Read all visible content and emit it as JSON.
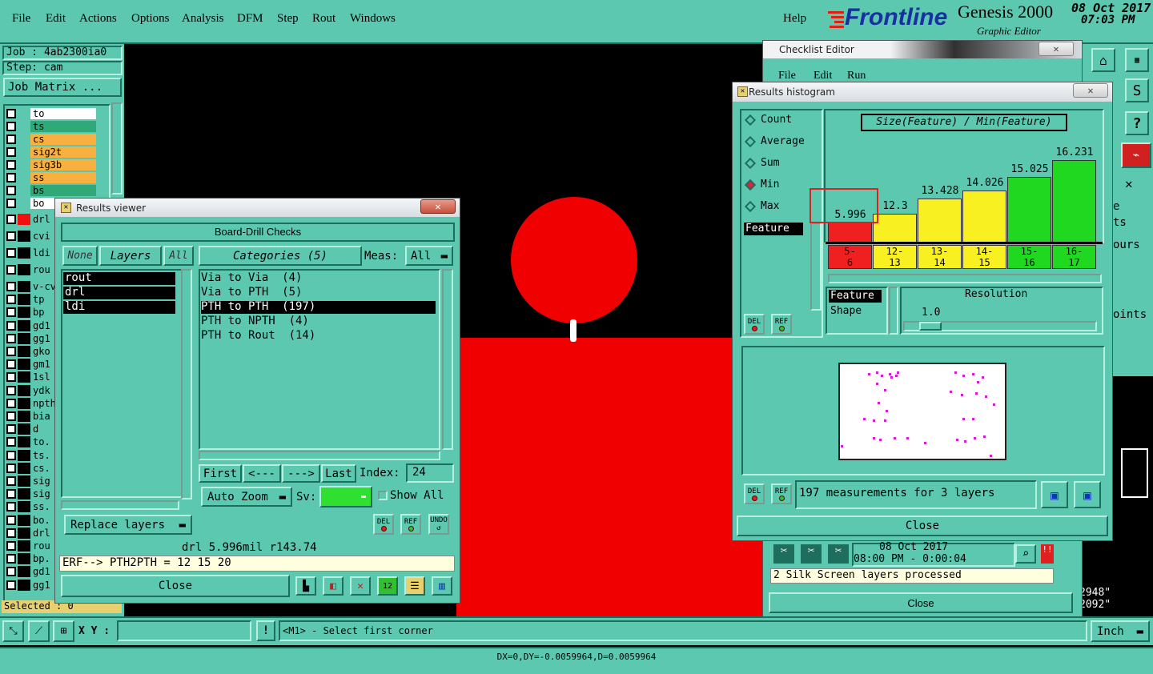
{
  "menubar": {
    "items": [
      "File",
      "Edit",
      "Actions",
      "Options",
      "Analysis",
      "DFM",
      "Step",
      "Rout",
      "Windows"
    ],
    "help": "Help",
    "brand": "Frontline",
    "product": "Genesis 2000",
    "product_sub": "Graphic Editor",
    "date": "08 Oct 2017",
    "time": "07:03 PM"
  },
  "job": {
    "job_label": "Job : 4ab2300ia0",
    "step_label": "Step: cam",
    "matrix_button": "Job Matrix ..."
  },
  "layers": {
    "top": [
      {
        "name": "to",
        "color": "#ffffff"
      },
      {
        "name": "ts",
        "color": "#30a878"
      },
      {
        "name": "cs",
        "color": "#f8b040"
      },
      {
        "name": "sig2t",
        "color": "#f8b040"
      },
      {
        "name": "sig3b",
        "color": "#f8b040"
      },
      {
        "name": "ss",
        "color": "#f8b040"
      },
      {
        "name": "bs",
        "color": "#30a878"
      },
      {
        "name": "bo",
        "color": "#ffffff"
      }
    ],
    "lower": [
      "drl",
      "cvi",
      "ldi",
      "rou",
      "v-cv",
      "tp",
      "bp",
      "gd1",
      "gg1",
      "gko",
      "gm1",
      "1sl",
      "ydk",
      "npth",
      "bia",
      "d",
      "to.",
      "ts.",
      "cs.",
      "sig",
      "sig",
      "ss.",
      "bo.",
      "drl",
      "rou",
      "bp.",
      "gd1",
      "gg1"
    ],
    "selected_label": "Selected : 0"
  },
  "results_viewer": {
    "title": "Results viewer",
    "header": "Board-Drill Checks",
    "none_btn": "None",
    "layers_btn": "Layers",
    "all_btn": "All",
    "categories_btn": "Categories (5)",
    "meas_label": "Meas:",
    "meas_value": "All",
    "layers": [
      "rout",
      "drl",
      "ldi"
    ],
    "categories": [
      "Via to Via  (4)",
      "Via to PTH  (5)",
      "PTH to PTH  (197)",
      "PTH to NPTH  (4)",
      "PTH to Rout  (14)"
    ],
    "selected_category": 2,
    "first": "First",
    "prev": "<---",
    "next": "--->",
    "last": "Last",
    "index_label": "Index:",
    "index_value": "24",
    "auto_zoom": "Auto Zoom",
    "sv_label": "Sv:",
    "show_all": "Show All",
    "replace_layers": "Replace layers",
    "del": "DEL",
    "ref": "REF",
    "undo": "UNDO",
    "status_line": "drl  5.996mil   r143.74",
    "erf_line": "ERF--> PTH2PTH = 12 15 20",
    "close": "Close"
  },
  "checklist_editor": {
    "title": "Checklist Editor",
    "menu": [
      "File",
      "Edit",
      "Run"
    ],
    "date": "08 Oct 2017",
    "time_line": "08:00 PM - 0:00:04",
    "status": "2 Silk Screen layers processed",
    "close": "Close"
  },
  "histogram": {
    "title": "Results histogram",
    "modes": [
      "Count",
      "Average",
      "Sum",
      "Min",
      "Max"
    ],
    "selected_mode": 3,
    "feature_label": "Feature",
    "chart_title": "Size(Feature) / Min(Feature)",
    "chart_data": {
      "type": "bar",
      "categories": [
        "5-6",
        "12-13",
        "13-14",
        "14-15",
        "15-16",
        "16-17"
      ],
      "values": [
        5.996,
        12.3,
        13.428,
        14.026,
        15.025,
        16.231
      ],
      "colors": [
        "#f02020",
        "#f8f020",
        "#f8f020",
        "#f8f020",
        "#20d820",
        "#20d820"
      ],
      "title": "Size(Feature) / Min(Feature)"
    },
    "bin_labels": [
      [
        "5-",
        "6"
      ],
      [
        "12-",
        "13"
      ],
      [
        "13-",
        "14"
      ],
      [
        "14-",
        "15"
      ],
      [
        "15-",
        "16"
      ],
      [
        "16-",
        "17"
      ]
    ],
    "feature_item": "Feature",
    "shape_item": "Shape",
    "resolution_label": "Resolution",
    "resolution_value": "1.0",
    "summary": "197 measurements for 3 layers",
    "del": "DEL",
    "ref": "REF",
    "close": "Close"
  },
  "right_strip": {
    "partial": [
      "e",
      "ts",
      "ours",
      "oints"
    ],
    "coord1": "2948\"",
    "coord2": "2092\""
  },
  "bottom": {
    "xy_label": "X Y :",
    "prompt": "<M1> - Select first corner",
    "units": "Inch",
    "status": "DX=0,DY=-0.0059964,D=0.0059964"
  }
}
